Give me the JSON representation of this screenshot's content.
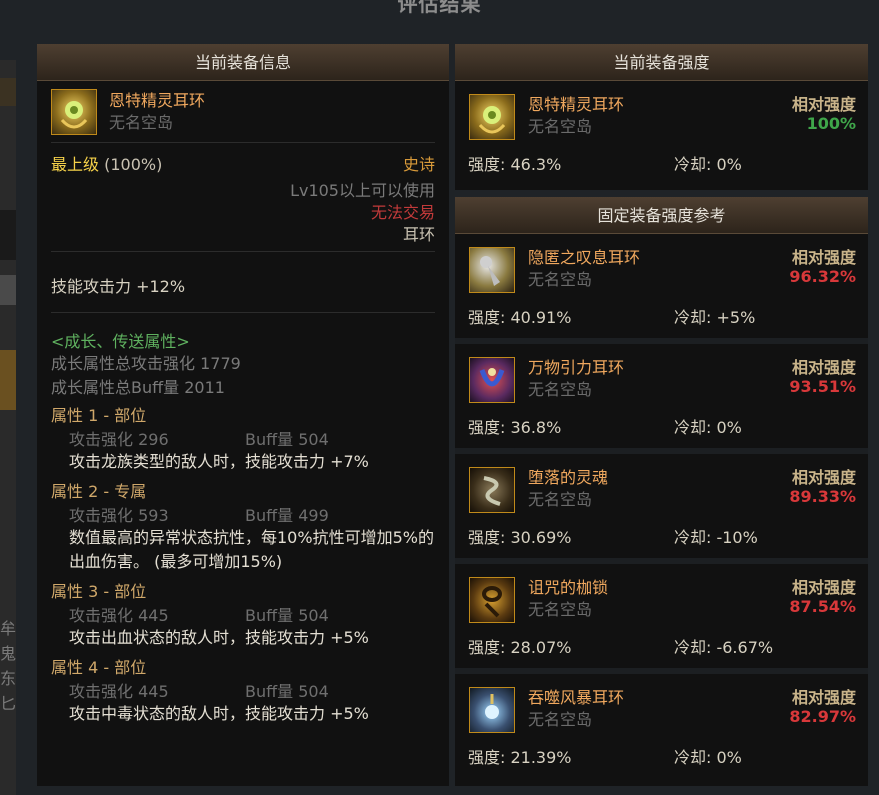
{
  "dialog": {
    "title": "评估结果"
  },
  "left_panel": {
    "header": "当前装备信息",
    "item": {
      "name": "恩特精灵耳环",
      "source": "无名空岛"
    },
    "grade": {
      "label": "最上级",
      "percent": "(100%)"
    },
    "rarity": "史诗",
    "requirement": "Lv105以上可以使用",
    "trade": "无法交易",
    "slot": "耳环",
    "skill_attack": "技能攻击力  +12%",
    "growth_title": "<成长、传送属性>",
    "growth_total_attack": "成长属性总攻击强化 1779",
    "growth_total_buff": "成长属性总Buff量 2011",
    "attributes": [
      {
        "title": "属性 1 - 部位",
        "attack": "攻击强化  296",
        "buff": "Buff量  504",
        "desc": "攻击龙族类型的敌人时，技能攻击力 +7%"
      },
      {
        "title": "属性 2 - 专属",
        "attack": "攻击强化  593",
        "buff": "Buff量  499",
        "desc": "数值最高的异常状态抗性，每10%抗性可增加5%的出血伤害。 (最多可增加15%)"
      },
      {
        "title": "属性 3 - 部位",
        "attack": "攻击强化  445",
        "buff": "Buff量  504",
        "desc": "攻击出血状态的敌人时，技能攻击力 +5%"
      },
      {
        "title": "属性 4 - 部位",
        "attack": "攻击强化  445",
        "buff": "Buff量  504",
        "desc": "攻击中毒状态的敌人时，技能攻击力 +5%"
      }
    ]
  },
  "current_strength": {
    "header": "当前装备强度",
    "item": {
      "name": "恩特精灵耳环",
      "source": "无名空岛",
      "rel_label": "相对强度",
      "rel_value": "100%",
      "strength": "强度: 46.3%",
      "cooldown": "冷却: 0%"
    }
  },
  "reference": {
    "header": "固定装备强度参考",
    "items": [
      {
        "name": "隐匿之叹息耳环",
        "source": "无名空岛",
        "rel_label": "相对强度",
        "rel_value": "96.32%",
        "strength": "强度: 40.91%",
        "cooldown": "冷却: +5%"
      },
      {
        "name": "万物引力耳环",
        "source": "无名空岛",
        "rel_label": "相对强度",
        "rel_value": "93.51%",
        "strength": "强度: 36.8%",
        "cooldown": "冷却: 0%"
      },
      {
        "name": "堕落的灵魂",
        "source": "无名空岛",
        "rel_label": "相对强度",
        "rel_value": "89.33%",
        "strength": "强度: 30.69%",
        "cooldown": "冷却: -10%"
      },
      {
        "name": "诅咒的枷锁",
        "source": "无名空岛",
        "rel_label": "相对强度",
        "rel_value": "87.54%",
        "strength": "强度: 28.07%",
        "cooldown": "冷却: -6.67%"
      },
      {
        "name": "吞噬风暴耳环",
        "source": "无名空岛",
        "rel_label": "相对强度",
        "rel_value": "82.97%",
        "strength": "强度: 21.39%",
        "cooldown": "冷却: 0%"
      }
    ]
  },
  "colors": {
    "green": "#3fa64a",
    "red": "#d8383a",
    "gold": "#f6d24a",
    "orange": "#f0a85e"
  },
  "background": {
    "left_strip_text": [
      "牟",
      "鬼",
      "东",
      "匕"
    ]
  }
}
